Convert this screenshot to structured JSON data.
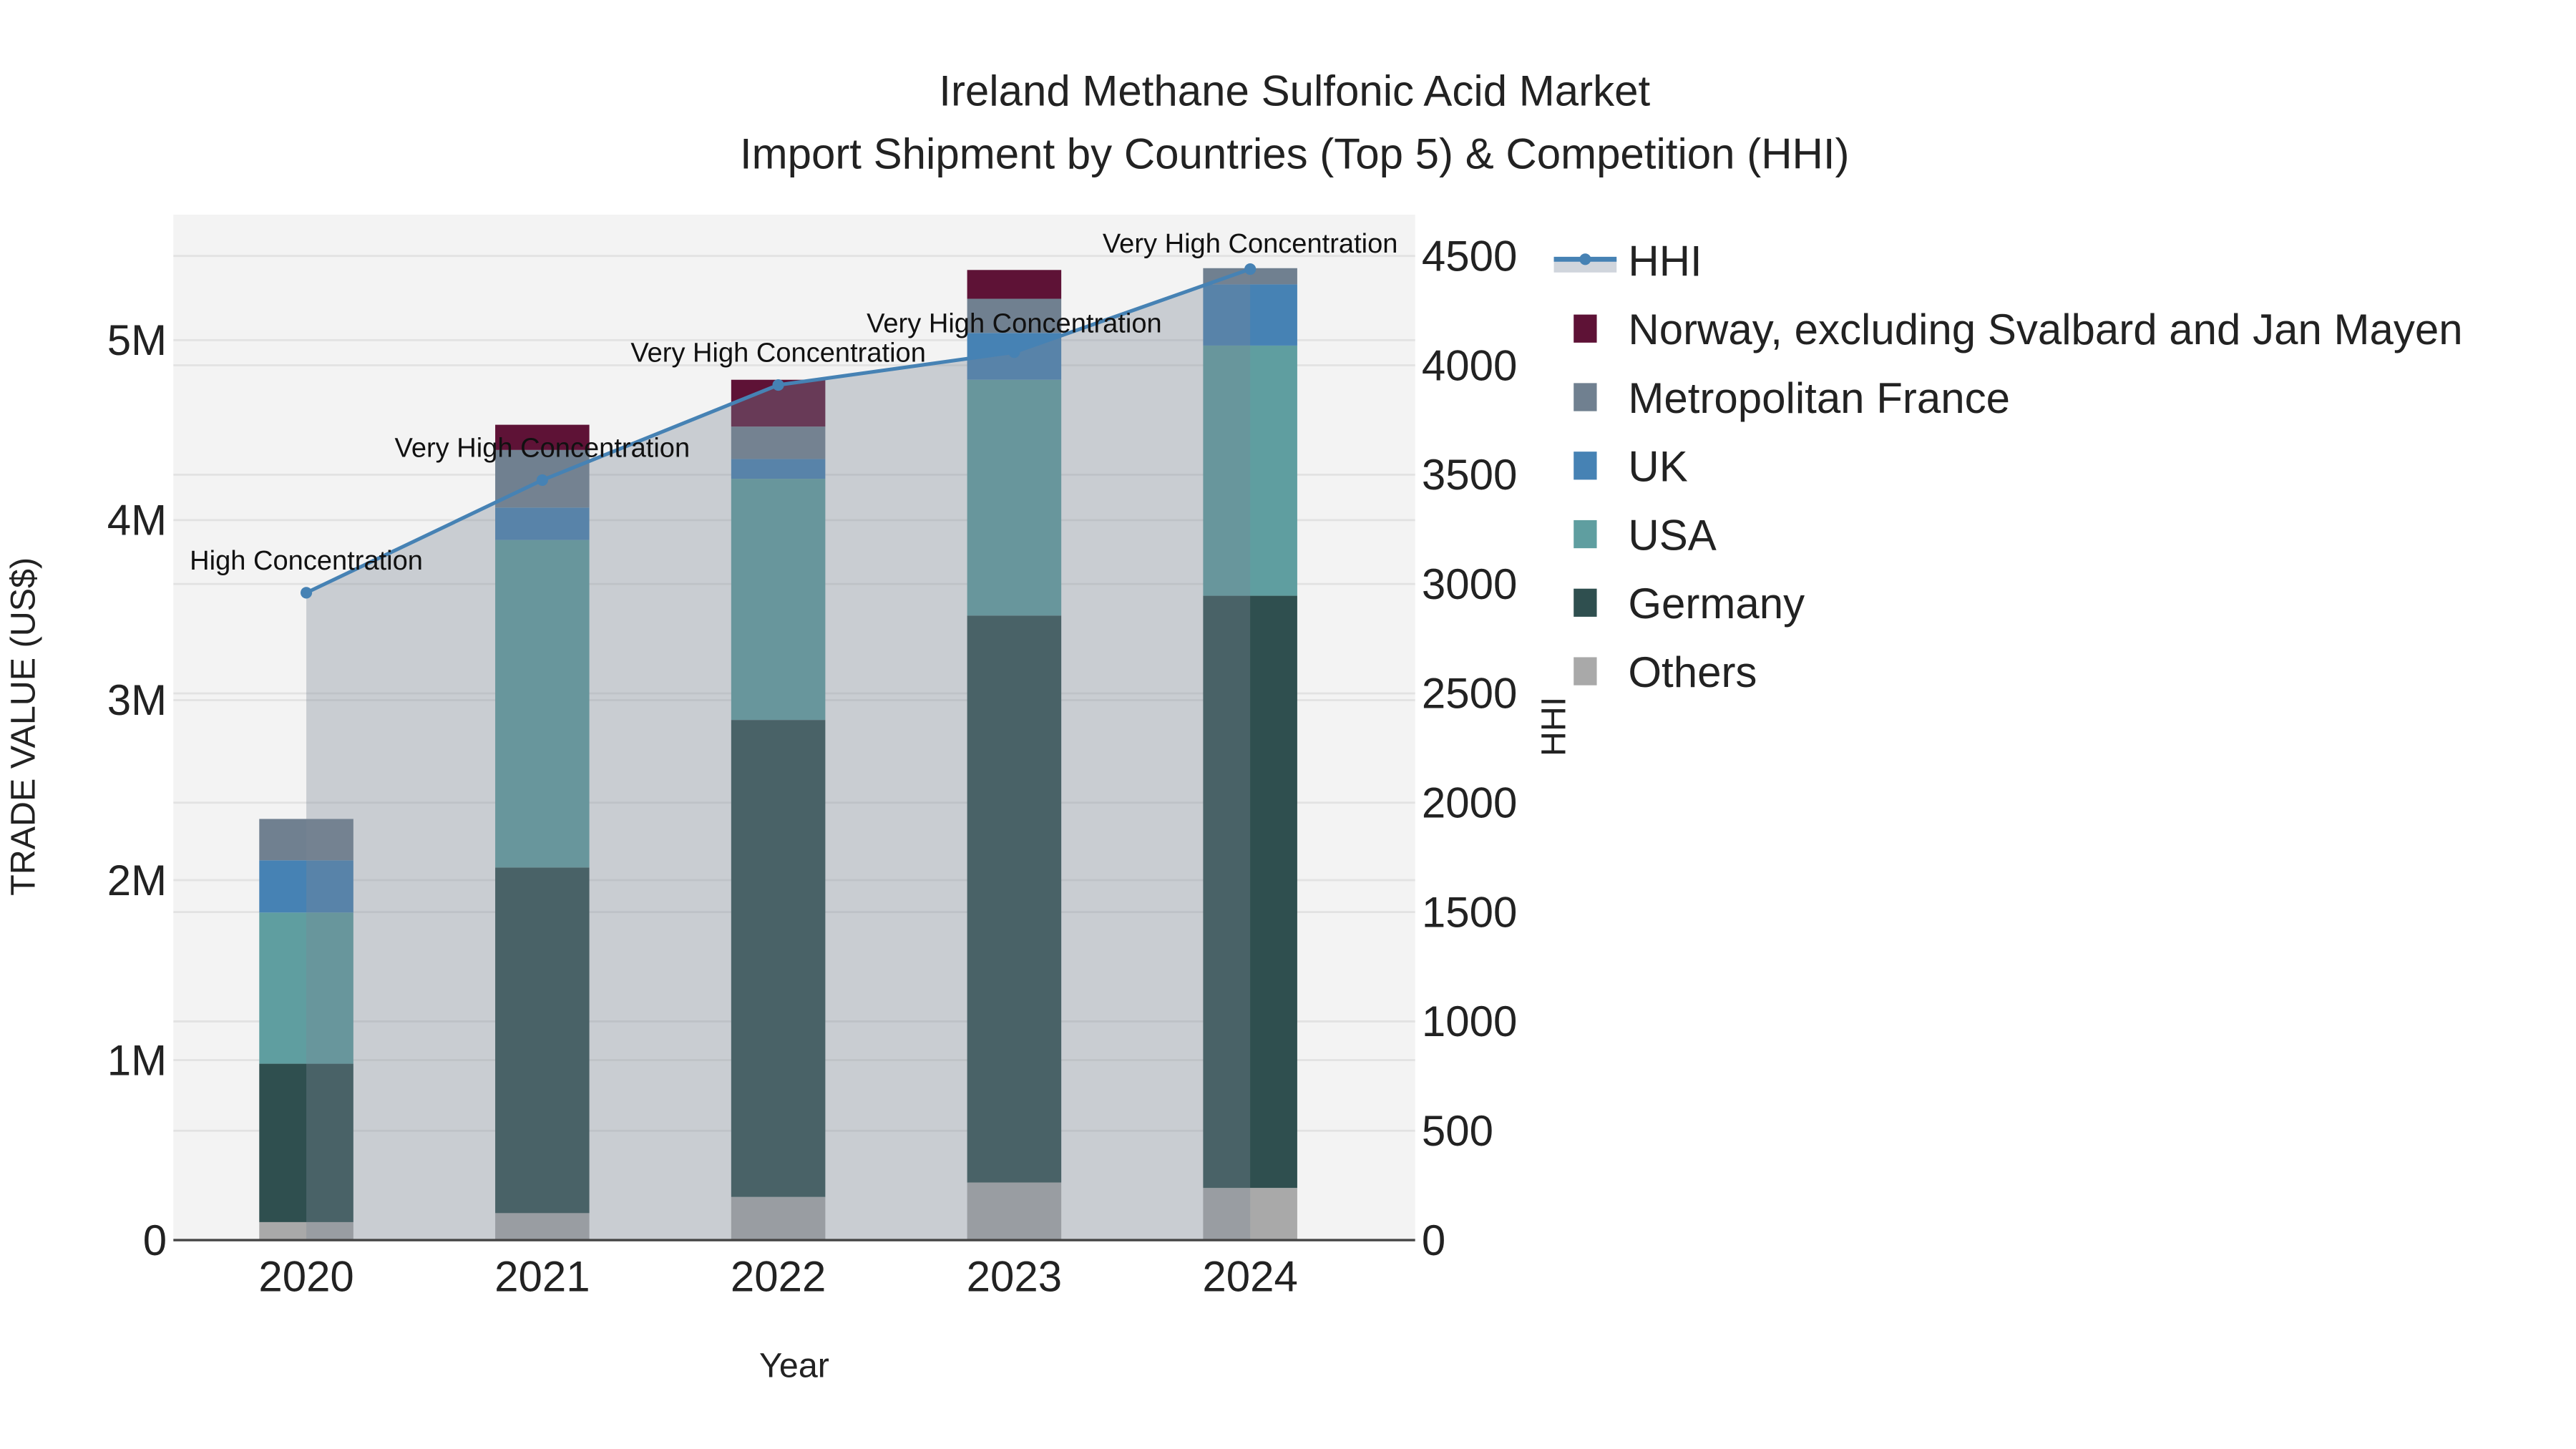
{
  "chart_data": {
    "type": "bar",
    "title": "Ireland Methane Sulfonic Acid Market",
    "subtitle": "Import Shipment by Countries (Top 5) & Competition (HHI)",
    "xlabel": "Year",
    "ylabel": "TRADE VALUE (US$)",
    "y2label": "HHI",
    "categories": [
      "2020",
      "2021",
      "2022",
      "2023",
      "2024"
    ],
    "ylim": [
      0,
      5700000
    ],
    "y_ticks": [
      0,
      1000000,
      2000000,
      3000000,
      4000000,
      5000000
    ],
    "y_tick_labels": [
      "0",
      "1M",
      "2M",
      "3M",
      "4M",
      "5M"
    ],
    "y2lim": [
      0,
      4700
    ],
    "y2_ticks": [
      0,
      500,
      1000,
      1500,
      2000,
      2500,
      3000,
      3500,
      4000,
      4500
    ],
    "y2_tick_labels": [
      "0",
      "500",
      "1000",
      "1500",
      "2000",
      "2500",
      "3000",
      "3500",
      "4000",
      "4500"
    ],
    "grid": true,
    "legend_placement": "right",
    "series": [
      {
        "name": "Others",
        "color": "#a9a9a9",
        "values": [
          100000,
          150000,
          240000,
          320000,
          290000
        ]
      },
      {
        "name": "Germany",
        "color": "#2f4f4f",
        "values": [
          880000,
          1920000,
          2650000,
          3150000,
          3290000
        ]
      },
      {
        "name": "USA",
        "color": "#5f9ea0",
        "values": [
          840000,
          1820000,
          1340000,
          1310000,
          1390000
        ]
      },
      {
        "name": "UK",
        "color": "#4682b4",
        "values": [
          290000,
          180000,
          110000,
          260000,
          340000
        ]
      },
      {
        "name": "Metropolitan France",
        "color": "#708090",
        "values": [
          230000,
          320000,
          180000,
          190000,
          90000
        ]
      },
      {
        "name": "Norway, excluding Svalbard and Jan Mayen",
        "color": "#5e1236",
        "values": [
          0,
          140000,
          260000,
          160000,
          0
        ]
      }
    ],
    "hhi": {
      "name": "HHI",
      "color": "#4682b4",
      "values": [
        2960,
        3475,
        3910,
        4060,
        4440
      ],
      "annotations": [
        "High Concentration",
        "Very High Concentration",
        "Very High Concentration",
        "Very High Concentration",
        "Very High Concentration"
      ]
    },
    "legend_order": [
      "HHI",
      "Norway, excluding Svalbard and Jan Mayen",
      "Metropolitan France",
      "UK",
      "USA",
      "Germany",
      "Others"
    ]
  }
}
